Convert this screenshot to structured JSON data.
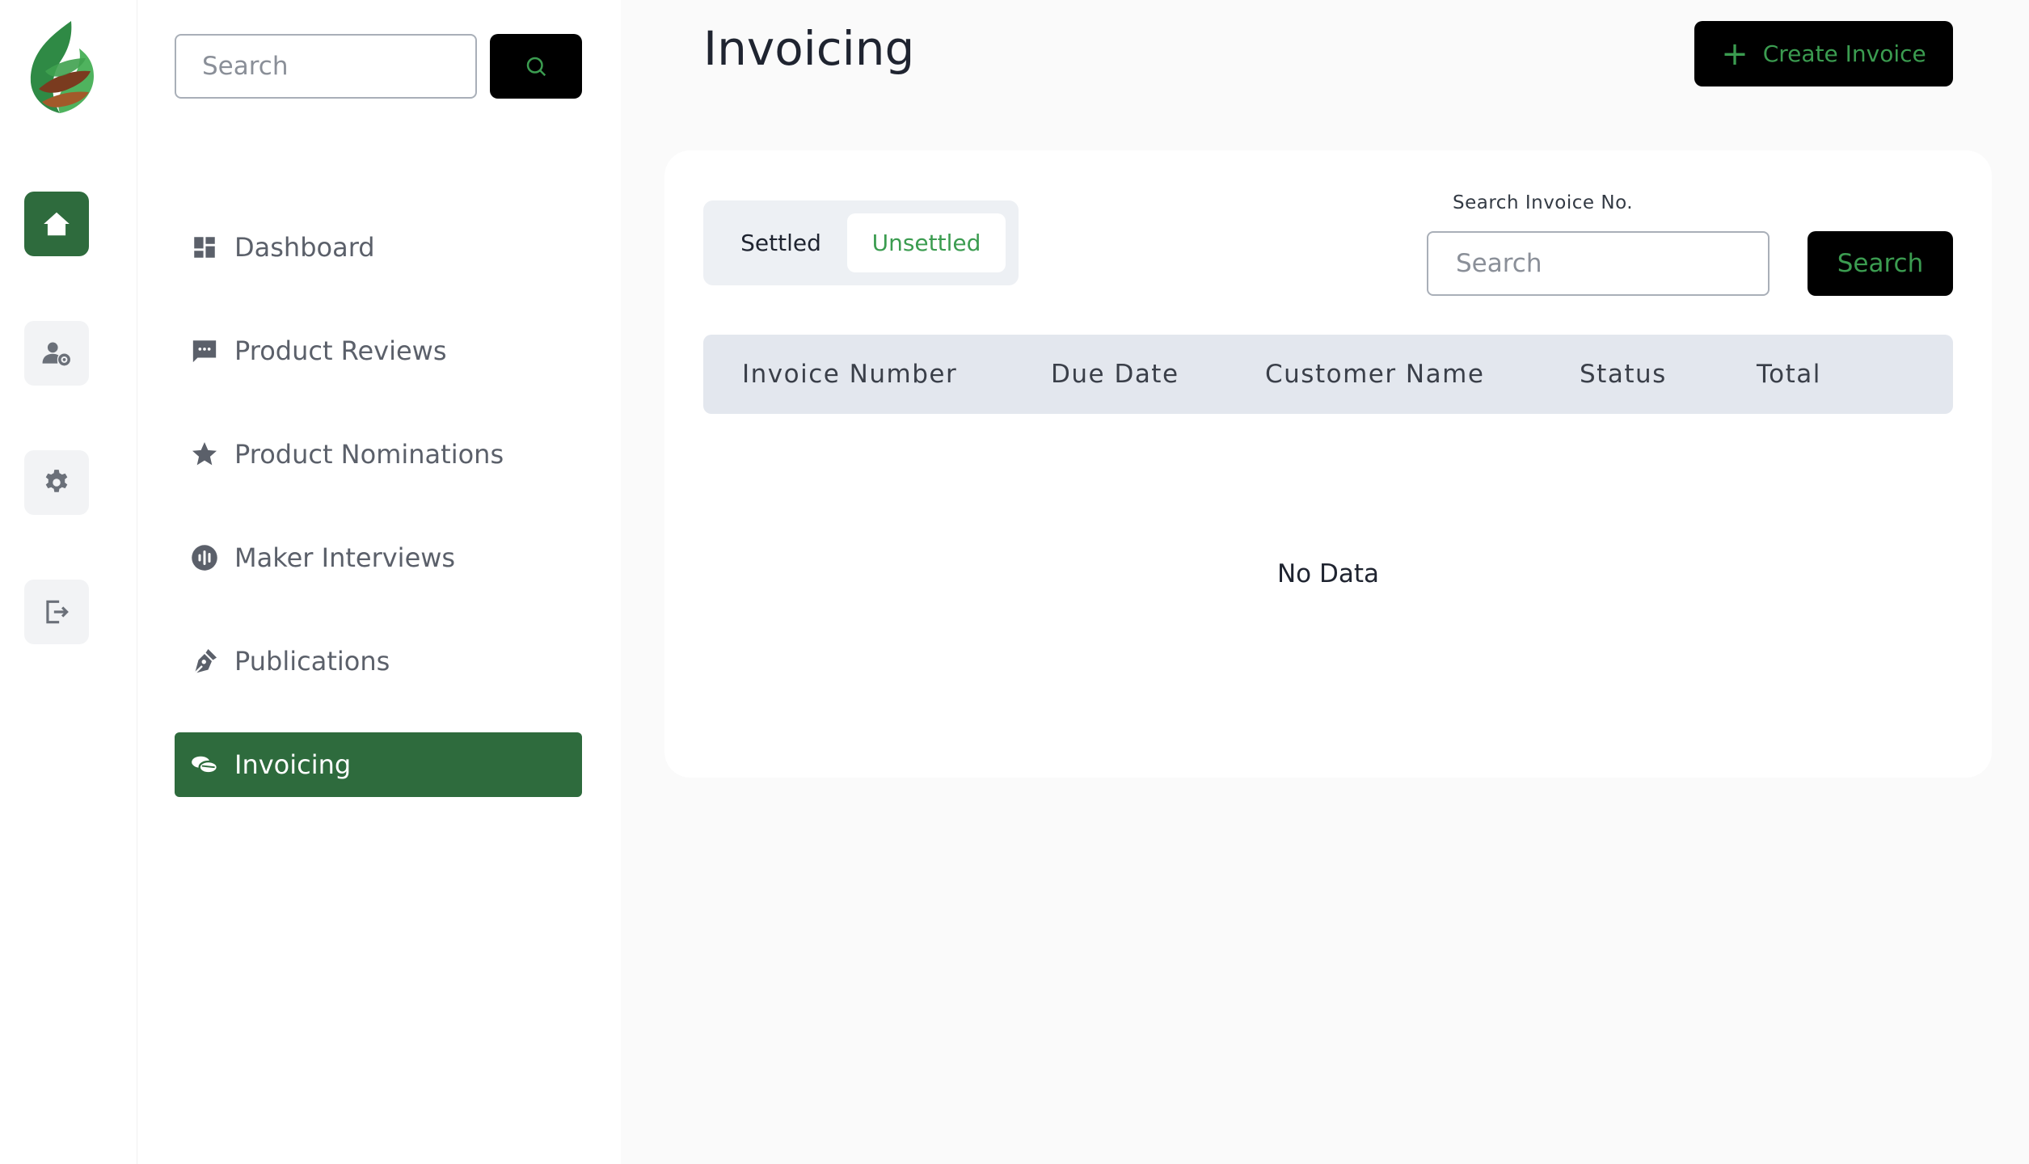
{
  "rail": {
    "items": [
      {
        "name": "home-icon",
        "active": true
      },
      {
        "name": "user-settings-icon",
        "active": false
      },
      {
        "name": "gear-icon",
        "active": false
      },
      {
        "name": "logout-icon",
        "active": false
      }
    ]
  },
  "nav": {
    "search_placeholder": "Search",
    "items": [
      {
        "label": "Dashboard",
        "icon": "dashboard-icon"
      },
      {
        "label": "Product Reviews",
        "icon": "chat-bubble-icon"
      },
      {
        "label": "Product Nominations",
        "icon": "star-icon"
      },
      {
        "label": "Maker Interviews",
        "icon": "podcast-icon"
      },
      {
        "label": "Publications",
        "icon": "pen-nib-icon"
      },
      {
        "label": "Invoicing",
        "icon": "coins-icon",
        "active": true
      }
    ]
  },
  "header": {
    "title": "Invoicing",
    "create_label": "Create Invoice"
  },
  "filters": {
    "tabs": [
      {
        "label": "Settled",
        "active": false
      },
      {
        "label": "Unsettled",
        "active": true
      }
    ],
    "invoice_search_label": "Search Invoice No.",
    "invoice_search_placeholder": "Search",
    "search_button": "Search"
  },
  "table": {
    "columns": [
      "Invoice Number",
      "Due Date",
      "Customer Name",
      "Status",
      "Total"
    ],
    "rows": [],
    "empty_text": "No Data"
  },
  "colors": {
    "brand_green": "#2e6b3d",
    "accent_green": "#3b9c50",
    "button_black": "#000000"
  }
}
